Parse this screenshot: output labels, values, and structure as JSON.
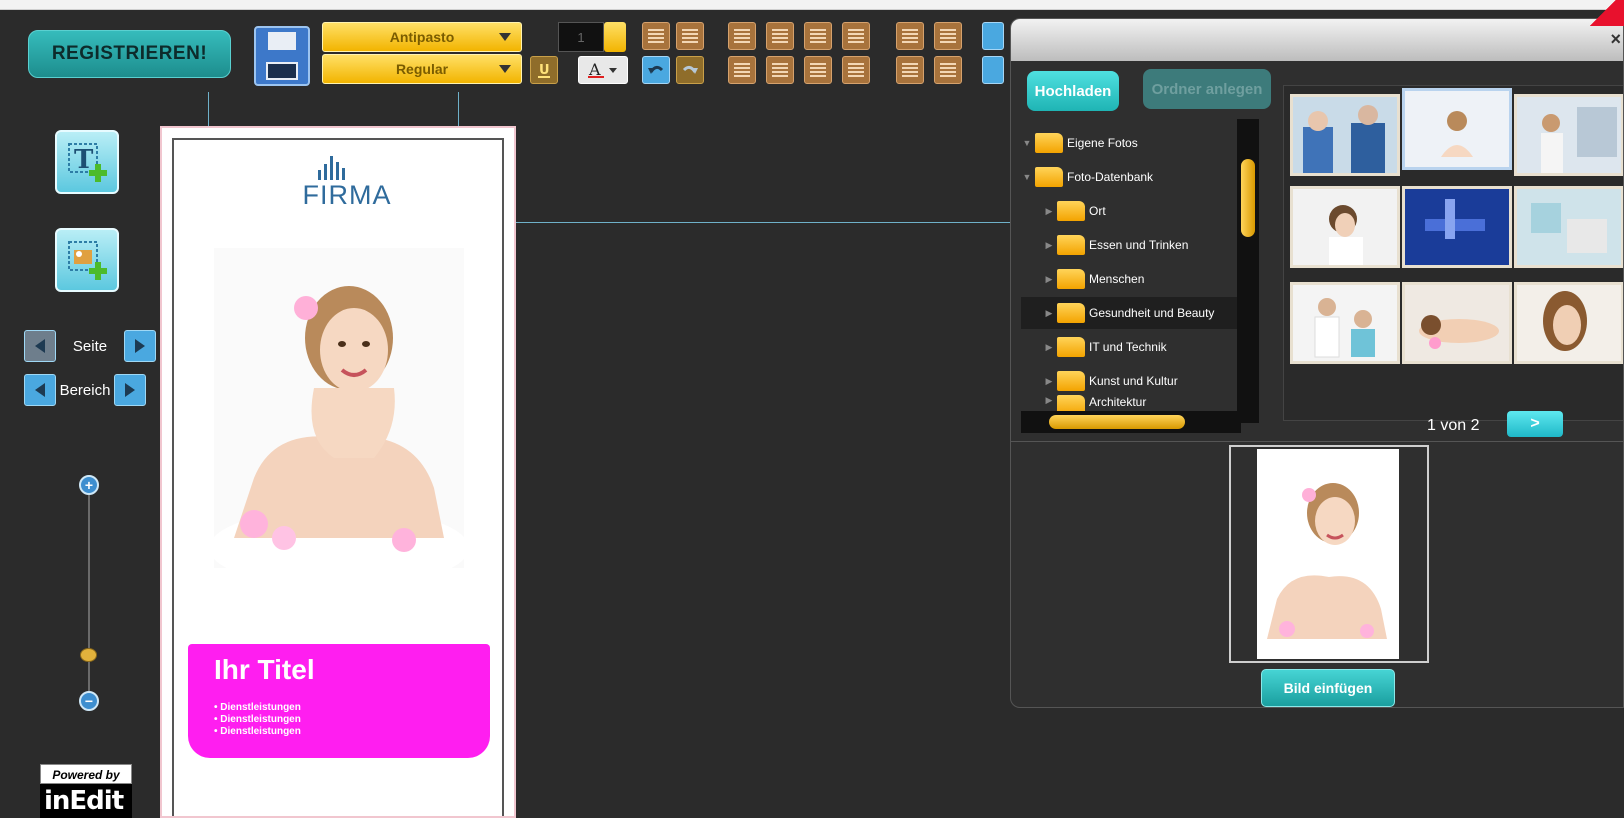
{
  "toolbar": {
    "register_label": "REGISTRIEREN!",
    "font_family": "Antipasto",
    "font_style": "Regular",
    "font_size": "1"
  },
  "left_panel": {
    "page_label": "Seite",
    "area_label": "Bereich",
    "powered_by": "Powered by",
    "powered_brand": "inEdit",
    "zoom_in": "+",
    "zoom_out": "−"
  },
  "document": {
    "logo_text": "FIRMA",
    "title": "Ihr Titel",
    "list_items": [
      "• Dienstleistungen",
      "• Dienstleistungen",
      "• Dienstleistungen"
    ]
  },
  "image_dialog": {
    "close_label": "×",
    "upload_label": "Hochladen",
    "create_folder_label": "Ordner anlegen",
    "folders": [
      {
        "label": "Eigene Fotos",
        "expanded": true,
        "level": 0
      },
      {
        "label": "Foto-Datenbank",
        "expanded": true,
        "level": 0
      },
      {
        "label": "Ort",
        "expanded": false,
        "level": 1
      },
      {
        "label": "Essen und Trinken",
        "expanded": false,
        "level": 1
      },
      {
        "label": "Menschen",
        "expanded": false,
        "level": 1
      },
      {
        "label": "Gesundheit und Beauty",
        "expanded": false,
        "level": 1,
        "selected": true
      },
      {
        "label": "IT und Technik",
        "expanded": false,
        "level": 1
      },
      {
        "label": "Kunst und Kultur",
        "expanded": false,
        "level": 1
      },
      {
        "label": "Architektur",
        "expanded": false,
        "level": 1
      }
    ],
    "pagination": "1 von 2",
    "next_label": ">",
    "insert_label": "Bild einfügen"
  },
  "colors": {
    "accent_teal": "#1fb4b4",
    "banner_magenta": "#ff1ef0",
    "gold": "#f2b400",
    "logo_blue": "#2f6b9c"
  }
}
